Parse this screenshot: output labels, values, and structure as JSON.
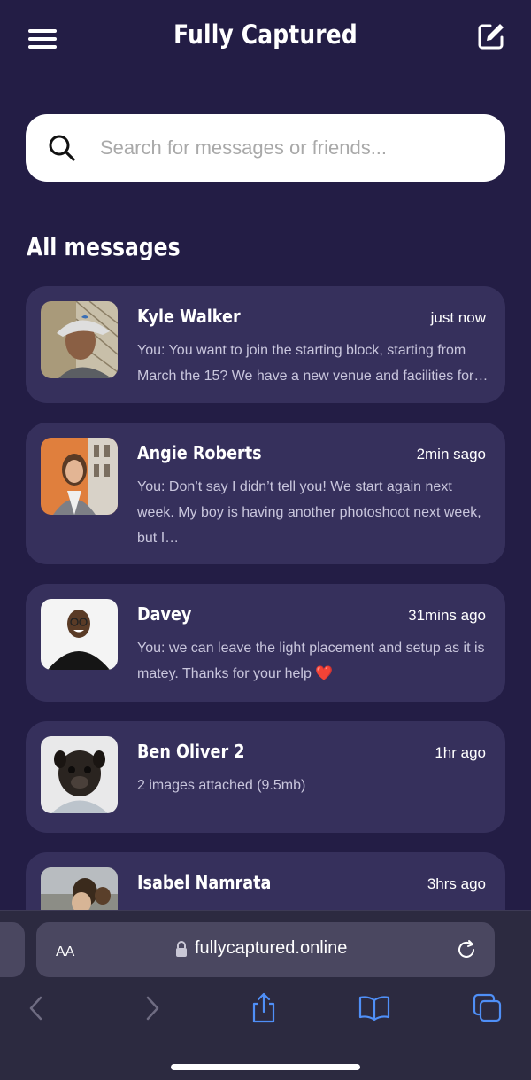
{
  "header": {
    "title": "Fully Captured",
    "menu_icon": "hamburger-menu-icon",
    "compose_icon": "compose-edit-icon"
  },
  "search": {
    "placeholder": "Search for messages or friends...",
    "value": "",
    "icon": "search-icon"
  },
  "section": {
    "title": "All messages"
  },
  "messages": [
    {
      "name": "Kyle Walker",
      "time": "just now",
      "preview": "You: You want to join the starting block, starting from March the 15? We have a new venue and facilities for…"
    },
    {
      "name": "Angie Roberts",
      "time": "2min sago",
      "preview": "You: Don’t say I didn’t tell you! We start again next week. My boy is having another photoshoot next week, but I…"
    },
    {
      "name": "Davey",
      "time": "31mins ago",
      "preview": "You: we can leave the light placement and setup as it is matey. Thanks for your help",
      "emoji": "❤️"
    },
    {
      "name": "Ben Oliver 2",
      "time": "1hr ago",
      "preview": "2 images attached (9.5mb)"
    },
    {
      "name": "Isabel Namrata",
      "time": "3hrs ago",
      "preview": ""
    }
  ],
  "browser": {
    "aa_label": "AA",
    "url": "fullycaptured.online",
    "icons": [
      "lock-icon",
      "reload-icon",
      "back-icon",
      "forward-icon",
      "share-icon",
      "bookmarks-icon",
      "tabs-icon"
    ]
  },
  "colors": {
    "background": "#231d45",
    "card": "#36305c",
    "accent": "#4f8ff7"
  }
}
